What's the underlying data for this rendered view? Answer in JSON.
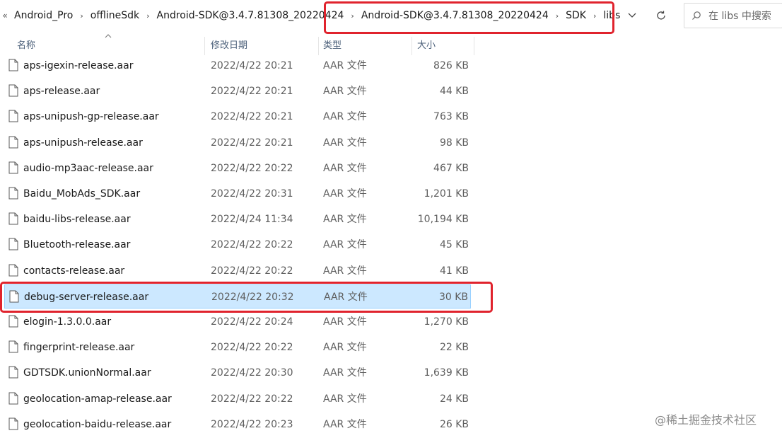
{
  "address_bar": {
    "overflow_glyph": "«",
    "breadcrumbs": [
      "Android_Pro",
      "offlineSdk",
      "Android-SDK@3.4.7.81308_20220424",
      "SDK",
      "libs"
    ],
    "separator": "›"
  },
  "search": {
    "placeholder": "在 libs 中搜索"
  },
  "columns": {
    "name": "名称",
    "date": "修改日期",
    "type": "类型",
    "size": "大小"
  },
  "files": [
    {
      "name": "aps-igexin-release.aar",
      "date": "2022/4/22 20:21",
      "type": "AAR 文件",
      "size": "826 KB"
    },
    {
      "name": "aps-release.aar",
      "date": "2022/4/22 20:21",
      "type": "AAR 文件",
      "size": "44 KB"
    },
    {
      "name": "aps-unipush-gp-release.aar",
      "date": "2022/4/22 20:21",
      "type": "AAR 文件",
      "size": "763 KB"
    },
    {
      "name": "aps-unipush-release.aar",
      "date": "2022/4/22 20:21",
      "type": "AAR 文件",
      "size": "98 KB"
    },
    {
      "name": "audio-mp3aac-release.aar",
      "date": "2022/4/22 20:22",
      "type": "AAR 文件",
      "size": "467 KB"
    },
    {
      "name": "Baidu_MobAds_SDK.aar",
      "date": "2022/4/22 20:31",
      "type": "AAR 文件",
      "size": "1,201 KB"
    },
    {
      "name": "baidu-libs-release.aar",
      "date": "2022/4/24 11:34",
      "type": "AAR 文件",
      "size": "10,194 KB"
    },
    {
      "name": "Bluetooth-release.aar",
      "date": "2022/4/22 20:22",
      "type": "AAR 文件",
      "size": "45 KB"
    },
    {
      "name": "contacts-release.aar",
      "date": "2022/4/22 20:22",
      "type": "AAR 文件",
      "size": "41 KB"
    },
    {
      "name": "debug-server-release.aar",
      "date": "2022/4/22 20:32",
      "type": "AAR 文件",
      "size": "30 KB",
      "selected": true
    },
    {
      "name": "elogin-1.3.0.0.aar",
      "date": "2022/4/22 20:24",
      "type": "AAR 文件",
      "size": "1,270 KB"
    },
    {
      "name": "fingerprint-release.aar",
      "date": "2022/4/22 20:22",
      "type": "AAR 文件",
      "size": "22 KB"
    },
    {
      "name": "GDTSDK.unionNormal.aar",
      "date": "2022/4/22 20:30",
      "type": "AAR 文件",
      "size": "1,639 KB"
    },
    {
      "name": "geolocation-amap-release.aar",
      "date": "2022/4/22 20:22",
      "type": "AAR 文件",
      "size": "24 KB"
    },
    {
      "name": "geolocation-baidu-release.aar",
      "date": "2022/4/22 20:23",
      "type": "AAR 文件",
      "size": "26 KB"
    }
  ],
  "watermark": "@稀土掘金技术社区",
  "icons": {
    "dropdown": "chevron-down-icon",
    "refresh": "refresh-icon",
    "search": "search-icon",
    "file": "file-icon",
    "sort": "sort-up-icon"
  },
  "colors": {
    "highlight_box": "#e0232d",
    "selection_bg": "#cce8ff",
    "selection_border": "#99d1ff",
    "header_text": "#4c607a"
  }
}
